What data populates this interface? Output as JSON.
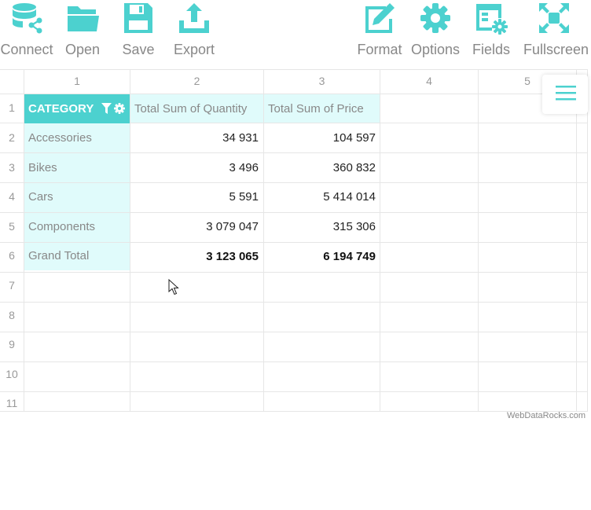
{
  "toolbar": {
    "left": [
      {
        "label": "Connect",
        "icon": "connect-icon"
      },
      {
        "label": "Open",
        "icon": "folder-icon"
      },
      {
        "label": "Save",
        "icon": "save-icon"
      },
      {
        "label": "Export",
        "icon": "export-icon"
      }
    ],
    "right": [
      {
        "label": "Format",
        "icon": "format-icon"
      },
      {
        "label": "Options",
        "icon": "gear-icon"
      },
      {
        "label": "Fields",
        "icon": "fields-icon"
      },
      {
        "label": "Fullscreen",
        "icon": "fullscreen-icon"
      }
    ]
  },
  "grid": {
    "column_headers": [
      "1",
      "2",
      "3",
      "4",
      "5"
    ],
    "row_headers": [
      "1",
      "2",
      "3",
      "4",
      "5",
      "6",
      "7",
      "8",
      "9",
      "10",
      "11"
    ],
    "category_header": "CATEGORY",
    "measure_headers": [
      "Total Sum of Quantity",
      "Total Sum of Price"
    ],
    "rows": [
      {
        "label": "Accessories",
        "quantity": "34 931",
        "price": "104 597"
      },
      {
        "label": "Bikes",
        "quantity": "3 496",
        "price": "360 832"
      },
      {
        "label": "Cars",
        "quantity": "5 591",
        "price": "5 414 014"
      },
      {
        "label": "Components",
        "quantity": "3 079 047",
        "price": "315 306"
      }
    ],
    "grand_total": {
      "label": "Grand Total",
      "quantity": "3 123 065",
      "price": "6 194 749"
    }
  },
  "brand": "WebDataRocks.com",
  "colors": {
    "accent": "#4cd1cf",
    "highlight": "#e0fbfb",
    "label": "#888888"
  }
}
